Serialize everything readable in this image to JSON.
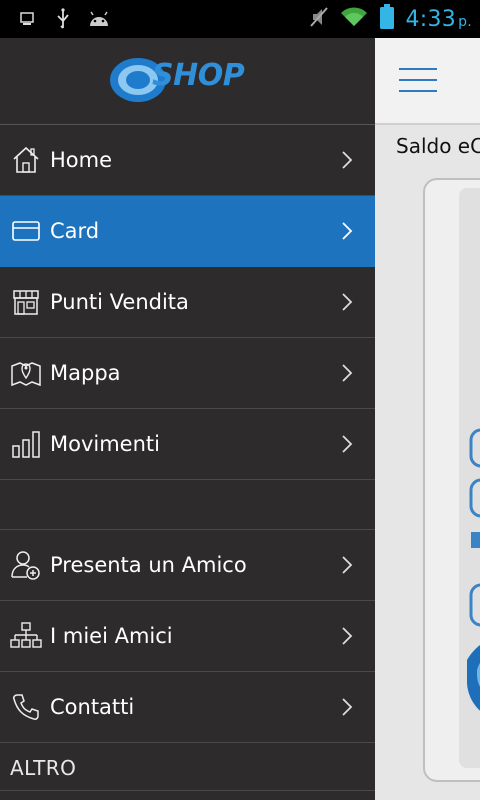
{
  "status_bar": {
    "time": "4:33",
    "ampm": "p.",
    "icons": [
      "storage-icon",
      "usb-icon",
      "android-icon",
      "mute-icon",
      "wifi-icon",
      "battery-icon"
    ]
  },
  "app": {
    "logo_text": "SHOP",
    "logo_prefix": "e",
    "accent_color": "#1e73be"
  },
  "menu": {
    "items": [
      {
        "label": "Home",
        "icon": "home-icon"
      },
      {
        "label": "Card",
        "icon": "card-icon",
        "active": true
      },
      {
        "label": "Punti Vendita",
        "icon": "store-icon"
      },
      {
        "label": "Mappa",
        "icon": "map-icon"
      },
      {
        "label": "Movimenti",
        "icon": "bar-chart-icon"
      },
      {
        "label": "Presenta un Amico",
        "icon": "add-user-icon"
      },
      {
        "label": "I miei Amici",
        "icon": "network-icon"
      },
      {
        "label": "Contatti",
        "icon": "phone-icon"
      }
    ],
    "section_other": "ALTRO"
  },
  "content": {
    "saldo_label": "Saldo eC"
  }
}
